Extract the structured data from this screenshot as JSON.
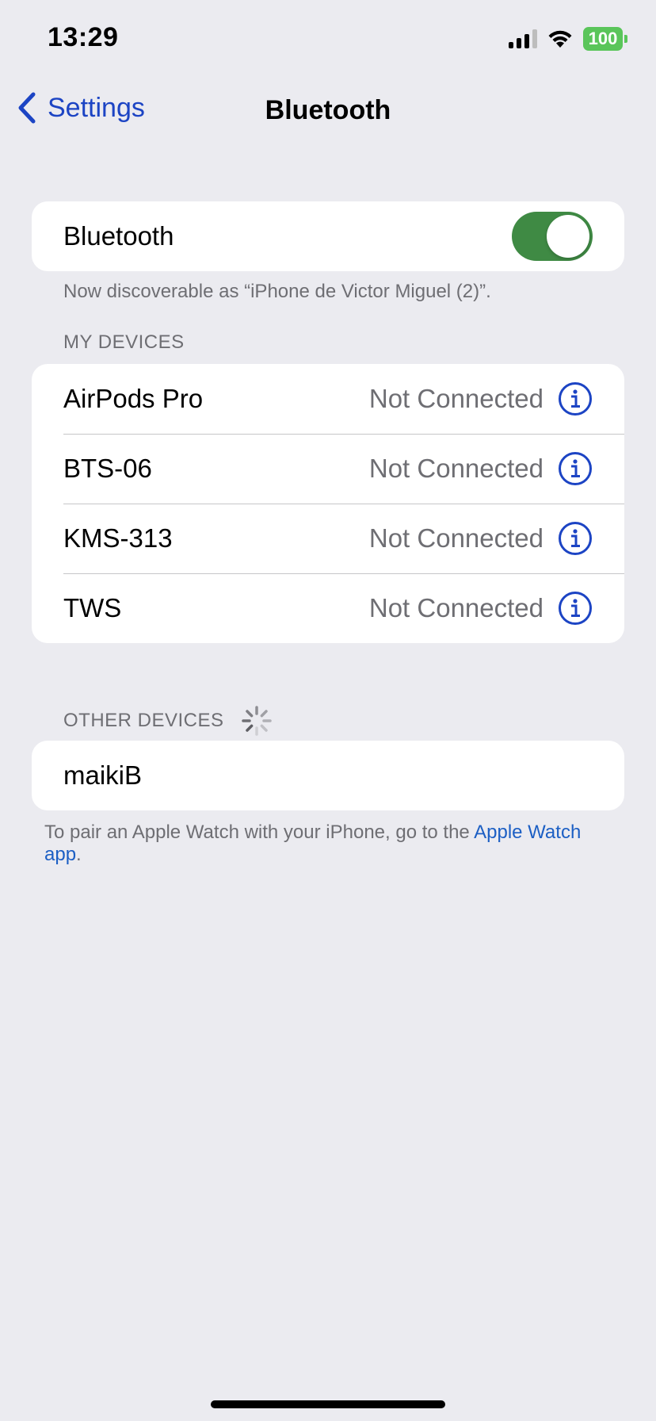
{
  "status_bar": {
    "time": "13:29",
    "battery": "100"
  },
  "nav": {
    "back_label": "Settings",
    "title": "Bluetooth"
  },
  "bluetooth": {
    "label": "Bluetooth",
    "enabled": true,
    "discoverable_note": "Now discoverable as “iPhone de Victor Miguel (2)”."
  },
  "my_devices": {
    "header": "MY DEVICES",
    "items": [
      {
        "name": "AirPods Pro",
        "status": "Not Connected"
      },
      {
        "name": "BTS-06",
        "status": "Not Connected"
      },
      {
        "name": "KMS-313",
        "status": "Not Connected"
      },
      {
        "name": "TWS",
        "status": "Not Connected"
      }
    ]
  },
  "other_devices": {
    "header": "OTHER DEVICES",
    "items": [
      {
        "name": "maikiB"
      }
    ]
  },
  "footer": {
    "text": "To pair an Apple Watch with your iPhone, go to the ",
    "link": "Apple Watch app",
    "end": "."
  },
  "colors": {
    "accent": "#1c44c4",
    "toggle_on": "#3f8a44",
    "battery": "#5ac55a",
    "background": "#ebebf0"
  }
}
